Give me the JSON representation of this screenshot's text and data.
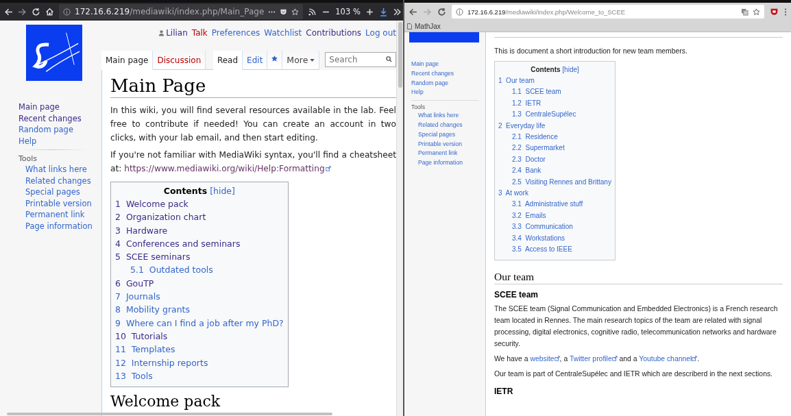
{
  "left_window": {
    "toolbar": {
      "url_host": "172.16.6.219",
      "url_path": "/mediawiki/index.php/Main_Page",
      "zoom": "103 %"
    },
    "personal_tools": [
      {
        "label": "Lilian",
        "visited": true,
        "missing": false
      },
      {
        "label": "Talk",
        "missing": true
      },
      {
        "label": "Preferences",
        "visited": false,
        "missing": false
      },
      {
        "label": "Watchlist",
        "visited": false,
        "missing": false
      },
      {
        "label": "Contributions",
        "visited": true,
        "missing": false
      },
      {
        "label": "Log out",
        "visited": false,
        "missing": false
      }
    ],
    "namespace_tabs": [
      {
        "label": "Main page",
        "selected": true,
        "missing": false
      },
      {
        "label": "Discussion",
        "selected": false,
        "missing": true
      }
    ],
    "view_tabs": [
      {
        "label": "Read",
        "selected": true,
        "missing": false
      },
      {
        "label": "Edit",
        "selected": false,
        "missing": false
      }
    ],
    "more_menu": "More",
    "search": {
      "placeholder": "Search"
    },
    "sidebar": {
      "navigation": [
        {
          "label": "Main page",
          "visited": true
        },
        {
          "label": "Recent changes",
          "visited": true
        },
        {
          "label": "Random page",
          "visited": false
        },
        {
          "label": "Help",
          "visited": false
        }
      ],
      "tools_heading": "Tools",
      "tools": [
        {
          "label": "What links here",
          "visited": false
        },
        {
          "label": "Related changes",
          "visited": false
        },
        {
          "label": "Special pages",
          "visited": false
        },
        {
          "label": "Printable version",
          "visited": false
        },
        {
          "label": "Permanent link",
          "visited": false
        },
        {
          "label": "Page information",
          "visited": false
        }
      ]
    },
    "title": "Main Page",
    "intro": "In this wiki, you will find several resources available in the lab. Feel free to contribute if needed! You can create an account in two clicks, with your lab email, and then start editing.",
    "syntax_text": "If you're not familiar with MediaWiki syntax, you'll find a cheatsheet at: ",
    "syntax_link": "https://www.mediawiki.org/wiki/Help:Formatting",
    "toc": {
      "title": "Contents",
      "hide": "[hide]",
      "items": [
        {
          "number": "1",
          "label": "Welcome pack",
          "visited": true
        },
        {
          "number": "2",
          "label": "Organization chart",
          "visited": true
        },
        {
          "number": "3",
          "label": "Hardware",
          "visited": true
        },
        {
          "number": "4",
          "label": "Conferences and seminars",
          "visited": true
        },
        {
          "number": "5",
          "label": "SCEE seminars",
          "visited": true,
          "children": [
            {
              "number": "5.1",
              "label": "Outdated tools",
              "visited": false
            }
          ]
        },
        {
          "number": "6",
          "label": "GouTP",
          "visited": true
        },
        {
          "number": "7",
          "label": "Journals",
          "visited": false
        },
        {
          "number": "8",
          "label": "Mobility grants",
          "visited": false
        },
        {
          "number": "9",
          "label": "Where can I find a job after my PhD?",
          "visited": false
        },
        {
          "number": "10",
          "label": "Tutorials",
          "visited": true
        },
        {
          "number": "11",
          "label": "Templates",
          "visited": false
        },
        {
          "number": "12",
          "label": "Internship reports",
          "visited": false
        },
        {
          "number": "13",
          "label": "Tools",
          "visited": false
        }
      ]
    },
    "next_heading": "Welcome pack"
  },
  "right_window": {
    "toolbar": {
      "url_host": "172.16.6.219",
      "url_path": "/mediawiki/index.php/Welcome_to_SCEE"
    },
    "bookmarks": [
      "MathJax"
    ],
    "sidebar": {
      "navigation": [
        "Main page",
        "Recent changes",
        "Random page",
        "Help"
      ],
      "tools_heading": "Tools",
      "tools": [
        "What links here",
        "Related changes",
        "Special pages",
        "Printable version",
        "Permanent link",
        "Page information"
      ]
    },
    "intro": "This is document a short introduction for new team members.",
    "toc": {
      "title": "Contents",
      "hide": "[hide]",
      "items": [
        {
          "number": "1",
          "label": "Our team",
          "children": [
            {
              "number": "1.1",
              "label": "SCEE team"
            },
            {
              "number": "1.2",
              "label": "IETR"
            },
            {
              "number": "1.3",
              "label": "CentraleSupélec"
            }
          ]
        },
        {
          "number": "2",
          "label": "Everyday life",
          "children": [
            {
              "number": "2.1",
              "label": "Residence"
            },
            {
              "number": "2.2",
              "label": "Supermarket"
            },
            {
              "number": "2.3",
              "label": "Doctor"
            },
            {
              "number": "2.4",
              "label": "Bank"
            },
            {
              "number": "2.5",
              "label": "Visiting Rennes and Brittany"
            }
          ]
        },
        {
          "number": "3",
          "label": "At work",
          "children": [
            {
              "number": "3.1",
              "label": "Administrative stuff"
            },
            {
              "number": "3.2",
              "label": "Emails"
            },
            {
              "number": "3.3",
              "label": "Communication"
            },
            {
              "number": "3.4",
              "label": "Workstations"
            },
            {
              "number": "3.5",
              "label": "Access to IEEE"
            }
          ]
        }
      ]
    },
    "section_heading": "Our team",
    "subsection_heading": "SCEE team",
    "description": "The SCEE team (Signal Communication and Embedded Electronics) is a French research team located in Rennes. The main research topics of the team are related with signal processing, digital electronics, cognitive radio, telecommunication networks and hardware security.",
    "links_sentence": [
      {
        "text": "We have a ",
        "link": false
      },
      {
        "text": "website",
        "link": true
      },
      {
        "text": ", a ",
        "link": false
      },
      {
        "text": "Twitter profile",
        "link": true
      },
      {
        "text": " and a ",
        "link": false
      },
      {
        "text": "Youtube channel",
        "link": true
      },
      {
        "text": ".",
        "link": false
      }
    ],
    "membership": "Our team is part of CentraleSupélec and IETR which are describerd in the next sections.",
    "next_heading": "IETR"
  }
}
